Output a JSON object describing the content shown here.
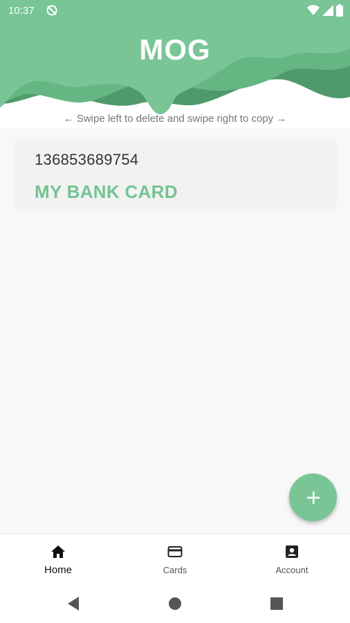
{
  "status_bar": {
    "time": "10:37"
  },
  "app": {
    "title": "MOG"
  },
  "hint": {
    "text": "← Swipe left to delete and swipe right to copy →"
  },
  "cards": [
    {
      "number": "136853689754",
      "name": "MY BANK CARD"
    }
  ],
  "fab": {
    "icon": "plus-icon"
  },
  "bottom_nav": {
    "items": [
      {
        "label": "Home",
        "icon": "home-icon",
        "active": true
      },
      {
        "label": "Cards",
        "icon": "credit-card-icon",
        "active": false
      },
      {
        "label": "Account",
        "icon": "account-box-icon",
        "active": false
      }
    ]
  },
  "colors": {
    "primary": "#79c596",
    "card_text": "#73c493",
    "header_dark": "#4f9a6b"
  }
}
